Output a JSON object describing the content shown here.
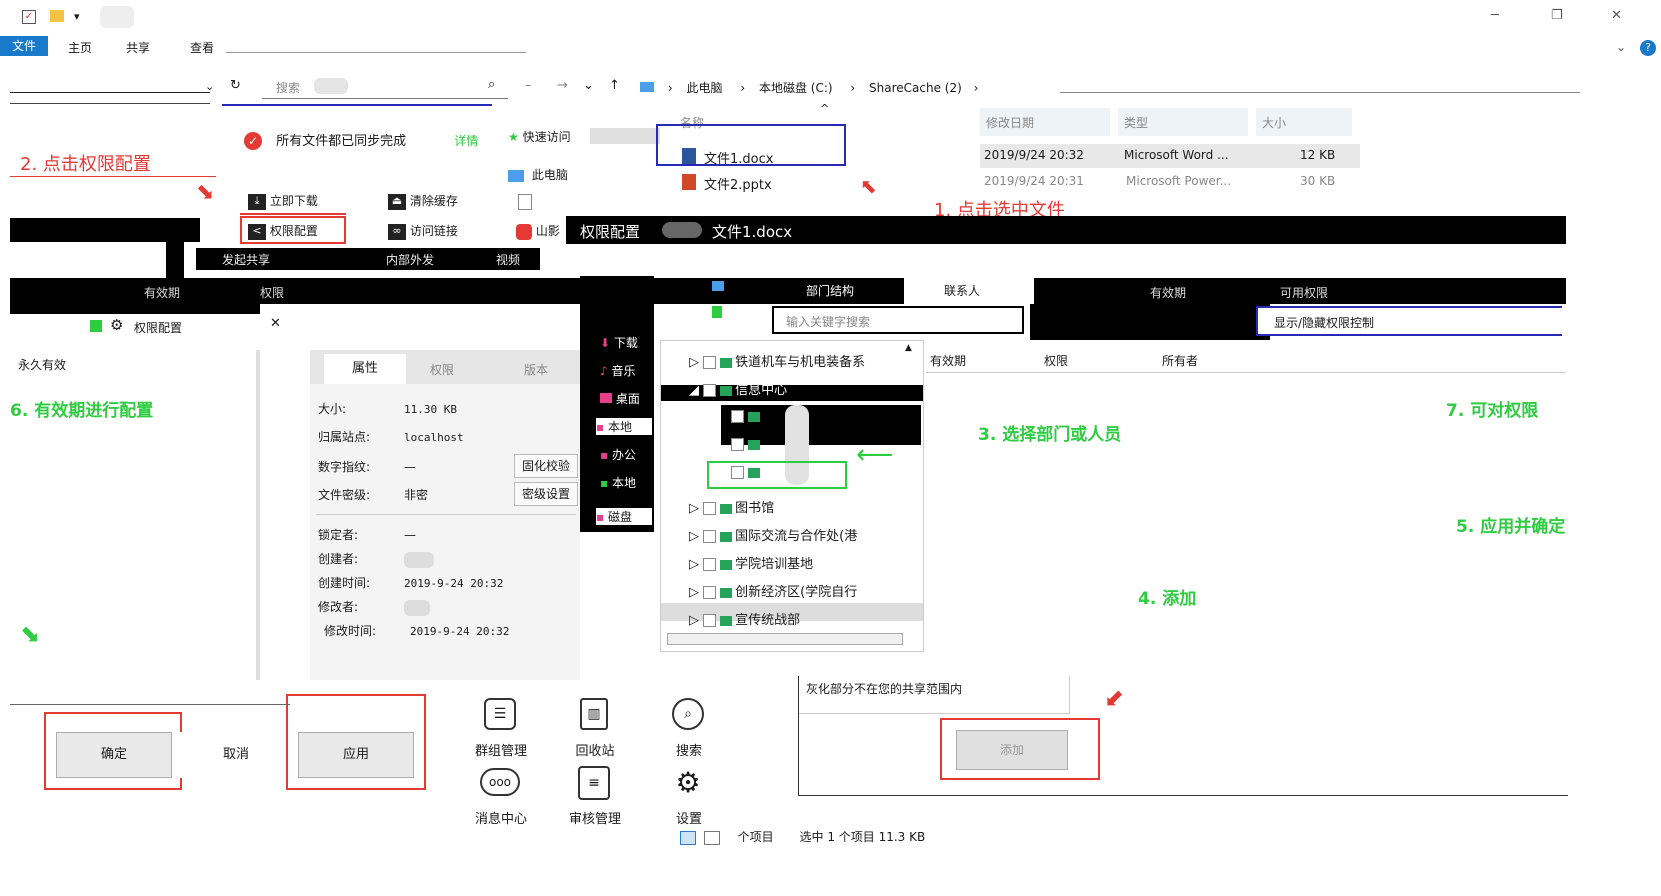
{
  "titlebar": {
    "controls": {
      "min": "─",
      "max": "❐",
      "close": "✕"
    }
  },
  "ribbon": {
    "tabs": [
      "文件",
      "主页",
      "共享",
      "查看"
    ]
  },
  "search": {
    "placeholder": "搜索",
    "value": ""
  },
  "address": {
    "crumbs": [
      "此电脑",
      "本地磁盘 (C:)",
      "ShareCache (2)"
    ]
  },
  "sync_panel": {
    "status": "所有文件都已同步完成",
    "detail": "详情",
    "quick_access": "快速访问",
    "this_pc": "此电脑",
    "actions": [
      "立即下载",
      "清除缓存",
      "权限配置",
      "访问链接",
      "山影"
    ],
    "actions2": [
      "发起共享",
      "内部外发",
      "视频"
    ]
  },
  "columns": {
    "name": "名称",
    "modified": "修改日期",
    "type": "类型",
    "size": "大小"
  },
  "files": [
    {
      "name": "文件1.docx",
      "modified": "2019/9/24 20:32",
      "type": "Microsoft Word ...",
      "size": "12 KB",
      "color": "#2b579a"
    },
    {
      "name": "文件2.pptx",
      "modified": "2019/9/24 20:31",
      "type": "Microsoft Power...",
      "size": "30 KB",
      "color": "#d24726"
    }
  ],
  "annotations": {
    "step1": "1. 点击选中文件",
    "step2": "2. 点击权限配置",
    "step3": "3. 选择部门或人员",
    "step4": "4. 添加",
    "step5": "5. 应用并确定",
    "step6": "6. 有效期进行配置",
    "step7": "7. 可对权限"
  },
  "perm_dialog": {
    "title": "权限配置",
    "file": "文件1.docx",
    "tabs": [
      "部门结构",
      "联系人"
    ],
    "search_placeholder": "输入关键字搜索",
    "cols": [
      "有效期",
      "权限",
      "所有者"
    ],
    "right_cols": [
      "有效期",
      "可用权限"
    ],
    "right_desc": "显示/隐藏权限控制",
    "valid": "永久有效",
    "note": "灰化部分不在您的共享范围内",
    "add": "添加",
    "left_cols": [
      "有效期",
      "权限"
    ],
    "left_header": "权限配置"
  },
  "properties": {
    "tabs": [
      "属性",
      "权限",
      "版本"
    ],
    "fields": [
      {
        "label": "大小:",
        "value": "11.30 KB"
      },
      {
        "label": "归属站点:",
        "value": "localhost"
      },
      {
        "label": "数字指纹:",
        "value": "—"
      },
      {
        "label": "文件密级:",
        "value": "非密"
      },
      {
        "label": "锁定者:",
        "value": "—"
      },
      {
        "label": "创建者:",
        "value": ""
      },
      {
        "label": "创建时间:",
        "value": "2019-9-24 20:32"
      },
      {
        "label": "修改者:",
        "value": ""
      },
      {
        "label": "修改时间:",
        "value": "2019-9-24 20:32"
      }
    ],
    "verify_btn": "固化校验",
    "level_btn": "密级设置"
  },
  "sidebar_items": [
    "下载",
    "音乐",
    "桌面",
    "本地",
    "办公",
    "本地",
    "磁盘"
  ],
  "tree": [
    "铁道机车与机电装备系",
    "信息中心",
    "",
    "",
    "",
    "图书馆",
    "国际交流与合作处(港",
    "学院培训基地",
    "创新经济区(学院自行",
    "宣传统战部"
  ],
  "bottom_buttons": {
    "ok": "确定",
    "cancel": "取消",
    "apply": "应用"
  },
  "tools": [
    {
      "icon": "group-manage-icon",
      "label": "群组管理"
    },
    {
      "icon": "recycle-bin-icon",
      "label": "回收站"
    },
    {
      "icon": "search-icon",
      "label": "搜索"
    },
    {
      "icon": "message-center-icon",
      "label": "消息中心"
    },
    {
      "icon": "audit-manage-icon",
      "label": "审核管理"
    },
    {
      "icon": "settings-icon",
      "label": "设置"
    }
  ],
  "statusbar": {
    "count": "个项目",
    "selected": "选中 1 个项目  11.3 KB"
  }
}
